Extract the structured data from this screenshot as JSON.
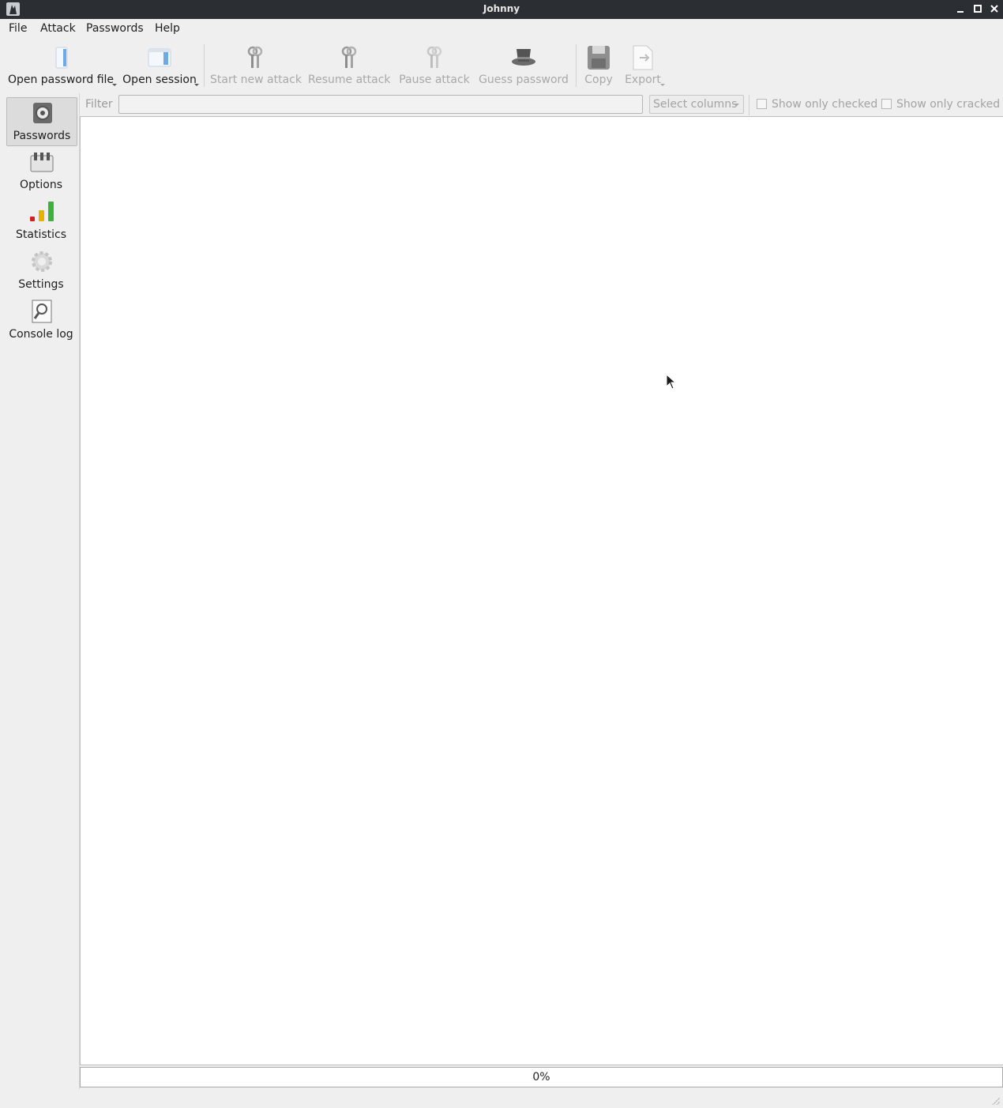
{
  "window": {
    "title": "Johnny"
  },
  "menu": {
    "items": [
      "File",
      "Attack",
      "Passwords",
      "Help"
    ]
  },
  "toolbar": {
    "open_password_file": "Open password file",
    "open_session": "Open session",
    "start_new_attack": "Start new attack",
    "resume_attack": "Resume attack",
    "pause_attack": "Pause attack",
    "guess_password": "Guess password",
    "copy": "Copy",
    "export": "Export"
  },
  "sidebar": {
    "items": [
      {
        "label": "Passwords",
        "icon": "safe-icon",
        "active": true
      },
      {
        "label": "Options",
        "icon": "options-icon"
      },
      {
        "label": "Statistics",
        "icon": "statistics-icon"
      },
      {
        "label": "Settings",
        "icon": "gear-icon"
      },
      {
        "label": "Console log",
        "icon": "console-log-icon"
      }
    ]
  },
  "filter": {
    "label": "Filter",
    "value": "",
    "select_columns": "Select columns",
    "show_only_checked": "Show only checked",
    "show_only_cracked": "Show only cracked"
  },
  "progress": {
    "value": 0,
    "label": "0%"
  },
  "colors": {
    "titlebar": "#2b2e33",
    "accent": "#3d8ee6"
  }
}
